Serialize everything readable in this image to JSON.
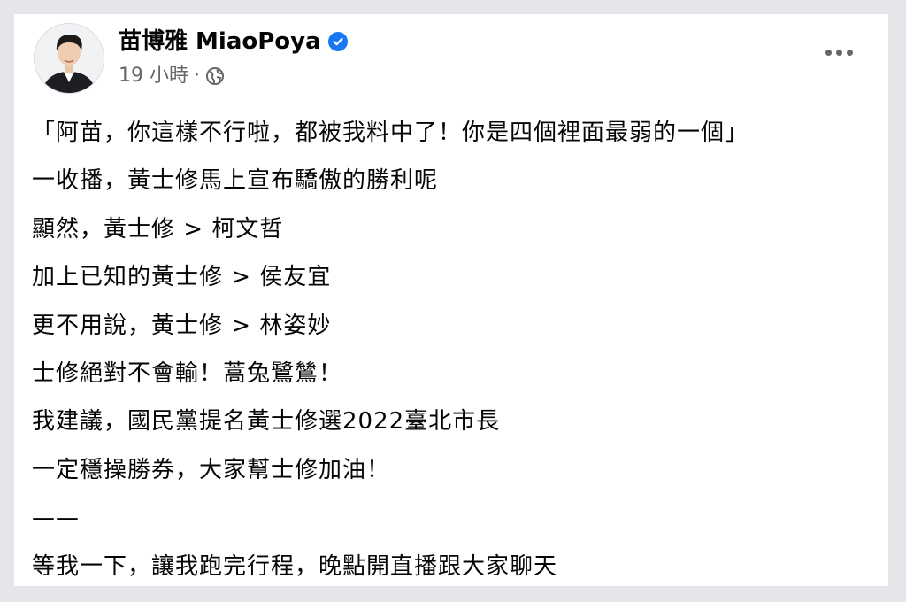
{
  "post": {
    "author": "苗博雅 MiaoPoya",
    "time": "19 小時",
    "separator": "·",
    "icons": {
      "verified": "verified-badge-icon",
      "audience": "globe-icon",
      "menu": "more-options-icon"
    },
    "colors": {
      "verified": "#1877f2",
      "meta_text": "#65676b",
      "background": "#e4e6e9"
    },
    "lines": [
      "「阿苗，你這樣不行啦，都被我料中了！你是四個裡面最弱的一個」",
      "一收播，黃士修馬上宣布驕傲的勝利呢",
      "顯然，黃士修 > 柯文哲",
      "加上已知的黃士修 > 侯友宜",
      "更不用說，黃士修 > 林姿妙",
      "士修絕對不會輸！蒿兔鷺鷥！",
      "我建議，國民黨提名黃士修選2022臺北市長",
      "一定穩操勝券，大家幫士修加油！",
      "——",
      "等我一下，讓我跑完行程，晚點開直播跟大家聊天"
    ]
  }
}
